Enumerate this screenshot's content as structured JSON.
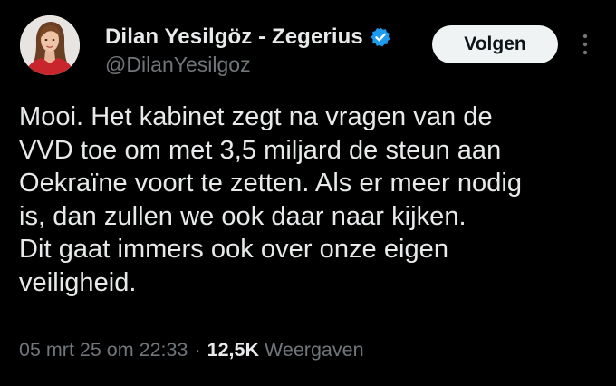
{
  "author": {
    "display_name": "Dilan Yesilgöz - Zegerius",
    "handle": "@DilanYesilgoz",
    "verified": true,
    "verified_icon": "verified-badge-icon",
    "avatar_icon": "profile-photo"
  },
  "actions": {
    "follow_label": "Volgen",
    "more_icon": "more-vertical-icon"
  },
  "tweet": {
    "text": "Mooi. Het kabinet zegt na vragen van de\nVVD toe om met 3,5 miljard de steun aan\nOekraïne voort te zetten. Als er meer nodig\nis, dan zullen we ook daar naar kijken.\nDit gaat immers ook over onze eigen\nveiligheid."
  },
  "meta": {
    "timestamp": "05 mrt 25 om 22:33",
    "separator": "·",
    "views_count": "12,5K",
    "views_label": "Weergaven"
  },
  "colors": {
    "background": "#000000",
    "text_primary": "#e7e9ea",
    "text_secondary": "#71767b",
    "verified_blue": "#1d9bf0",
    "button_bg": "#eff3f4",
    "button_text": "#0f1419"
  }
}
